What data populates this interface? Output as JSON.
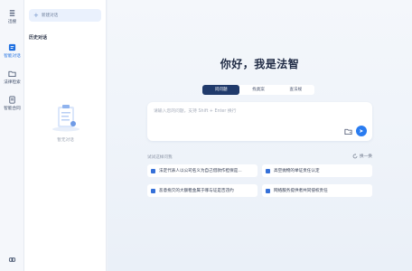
{
  "rail": {
    "items": [
      {
        "label": "迅搜",
        "icon": "menu-icon"
      },
      {
        "label": "智能对话",
        "icon": "chat-cube-icon"
      },
      {
        "label": "法律检索",
        "icon": "folder-icon"
      },
      {
        "label": "智能合同",
        "icon": "contract-icon"
      }
    ],
    "bottom_icon": "link-icon"
  },
  "history": {
    "new_chat_label": "新建对话",
    "title": "历史对话",
    "empty_text": "暂无对话"
  },
  "main": {
    "greeting": "你好，我是法智",
    "tabs": [
      {
        "label": "问问题",
        "active": true
      },
      {
        "label": "找类案",
        "active": false
      },
      {
        "label": "查法规",
        "active": false
      }
    ],
    "input": {
      "placeholder": "请输入您的问题，支持 Shift + Enter 换行"
    },
    "suggestions_title": "试试这样问我",
    "refresh_label": "换一换",
    "suggestions": [
      "法定代表人以公司名义为自己借款作担保是...",
      "高空抛物的举证责任认定",
      "恶意拖欠的大额租金属于哪与证是否违约",
      "网络服务提供者共同侵权责任"
    ]
  },
  "colors": {
    "accent": "#2a7cf0",
    "tab_active": "#203a6b",
    "card_icon": "#3570d8"
  }
}
